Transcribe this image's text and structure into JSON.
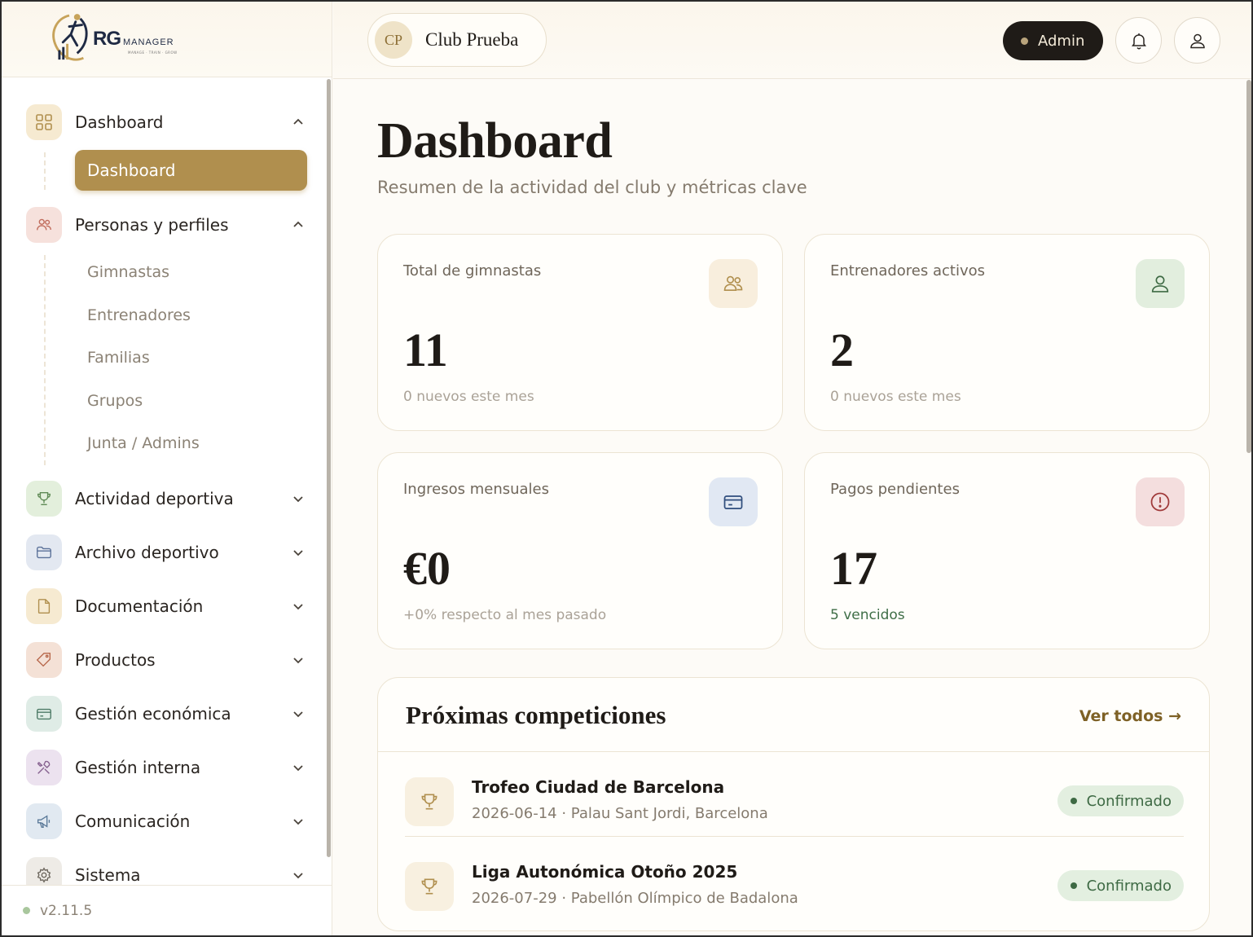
{
  "brand": {
    "rg": "RG",
    "manager": "MANAGER",
    "tagline": "MANAGE · TRAIN · GROW"
  },
  "header": {
    "club_initials": "CP",
    "club_name": "Club Prueba",
    "role_label": "Admin"
  },
  "sidebar": {
    "groups": [
      {
        "label": "Dashboard",
        "icon": "grid-icon",
        "expanded": true,
        "color": "#f6ead1"
      },
      {
        "label": "Personas y perfiles",
        "icon": "users-icon",
        "expanded": true,
        "color": "#f6e1dc"
      },
      {
        "label": "Actividad deportiva",
        "icon": "trophy-icon",
        "expanded": false,
        "color": "#e3efdc"
      },
      {
        "label": "Archivo deportivo",
        "icon": "folder-icon",
        "expanded": false,
        "color": "#e3e8f1"
      },
      {
        "label": "Documentación",
        "icon": "file-icon",
        "expanded": false,
        "color": "#f6ead1"
      },
      {
        "label": "Productos",
        "icon": "tag-icon",
        "expanded": false,
        "color": "#f4e1d6"
      },
      {
        "label": "Gestión económica",
        "icon": "card-icon",
        "expanded": false,
        "color": "#dfece6"
      },
      {
        "label": "Gestión interna",
        "icon": "tools-icon",
        "expanded": false,
        "color": "#ece2ef"
      },
      {
        "label": "Comunicación",
        "icon": "megaphone-icon",
        "expanded": false,
        "color": "#e1e9f1"
      },
      {
        "label": "Sistema",
        "icon": "gear-icon",
        "expanded": false,
        "color": "#eeebe6"
      }
    ],
    "dashboard_sub": "Dashboard",
    "personas_sub": [
      "Gimnastas",
      "Entrenadores",
      "Familias",
      "Grupos",
      "Junta / Admins"
    ],
    "version": "v2.11.5"
  },
  "main": {
    "title": "Dashboard",
    "subtitle": "Resumen de la actividad del club y métricas clave",
    "stats": [
      {
        "label": "Total de gimnastas",
        "value": "11",
        "note": "0 nuevos este mes",
        "icon": "users-icon",
        "bg": "#f8eedd",
        "fg": "#b08f4e"
      },
      {
        "label": "Entrenadores activos",
        "value": "2",
        "note": "0 nuevos este mes",
        "icon": "user-icon",
        "bg": "#e2eede",
        "fg": "#3e6a44"
      },
      {
        "label": "Ingresos mensuales",
        "value": "€0",
        "note": "+0% respecto al mes pasado",
        "icon": "card-icon",
        "bg": "#e1e8f3",
        "fg": "#2f4d7d"
      },
      {
        "label": "Pagos pendientes",
        "value": "17",
        "note": "5 vencidos",
        "icon": "alert-icon",
        "bg": "#f4dede",
        "fg": "#a03a3a"
      }
    ],
    "competitions": {
      "title": "Próximas competiciones",
      "see_all": "Ver todos →",
      "items": [
        {
          "name": "Trofeo Ciudad de Barcelona",
          "meta": "2026-06-14 · Palau Sant Jordi, Barcelona",
          "status": "Confirmado"
        },
        {
          "name": "Liga Autonómica Otoño 2025",
          "meta": "2026-07-29 · Pabellón Olímpico de Badalona",
          "status": "Confirmado"
        }
      ]
    }
  }
}
